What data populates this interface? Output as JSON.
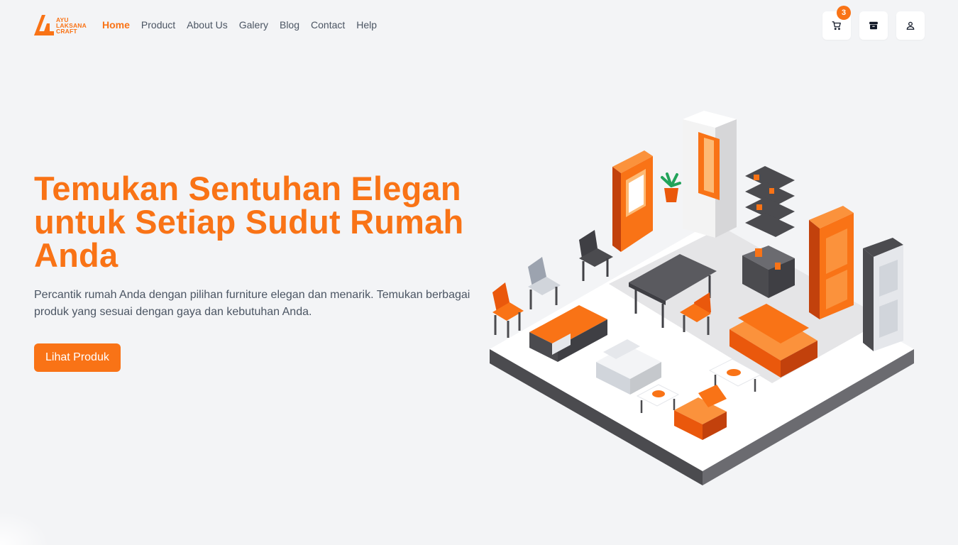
{
  "brand": {
    "name_lines": [
      "AYU",
      "LAKSANA",
      "CRAFT"
    ],
    "color": "#f97316"
  },
  "nav": {
    "items": [
      {
        "label": "Home",
        "active": true
      },
      {
        "label": "Product",
        "active": false
      },
      {
        "label": "About Us",
        "active": false
      },
      {
        "label": "Galery",
        "active": false
      },
      {
        "label": "Blog",
        "active": false
      },
      {
        "label": "Contact",
        "active": false
      },
      {
        "label": "Help",
        "active": false
      }
    ]
  },
  "actions": {
    "cart": {
      "icon": "cart-icon",
      "count": "3"
    },
    "orders": {
      "icon": "archive-icon"
    },
    "account": {
      "icon": "user-icon"
    }
  },
  "hero": {
    "title": "Temukan Sentuhan Elegan untuk Setiap Sudut Rumah Anda",
    "description": "Percantik rumah Anda dengan pilihan furniture elegan dan menarik. Temukan berbagai produk yang sesuai dengan gaya dan kebutuhan Anda.",
    "cta_label": "Lihat Produk"
  },
  "colors": {
    "accent": "#f97316",
    "background": "#f3f4f6",
    "text": "#4b5563",
    "dark_gray": "#4b4b4f"
  }
}
